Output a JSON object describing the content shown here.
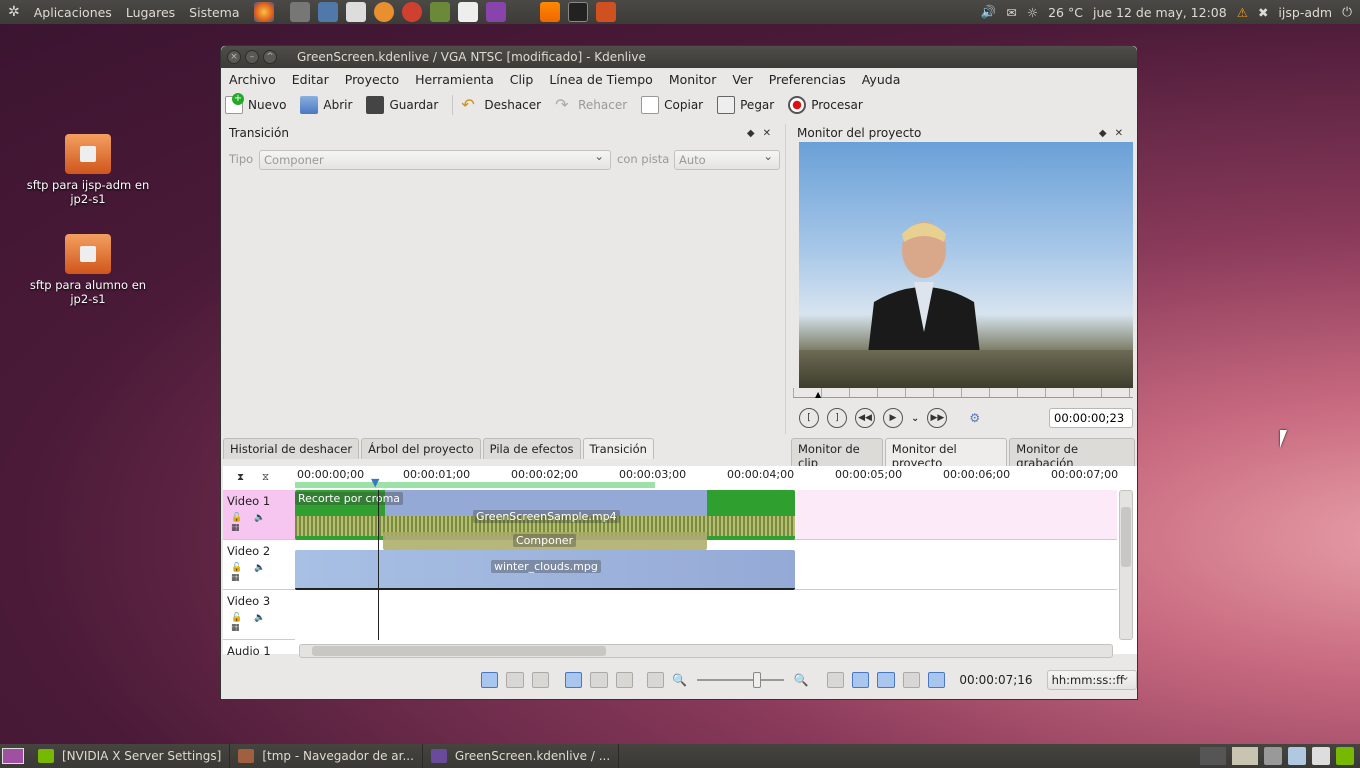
{
  "top_panel": {
    "menus": [
      "Aplicaciones",
      "Lugares",
      "Sistema"
    ],
    "weather": "26 °C",
    "datetime": "jue 12 de may, 12:08",
    "user": "ijsp-adm"
  },
  "desktop_icons": [
    {
      "label": "sftp para ijsp-adm en jp2-s1"
    },
    {
      "label": "sftp para alumno en jp2-s1"
    }
  ],
  "window": {
    "title": "GreenScreen.kdenlive / VGA NTSC [modificado] - Kdenlive",
    "menus": [
      "Archivo",
      "Editar",
      "Proyecto",
      "Herramienta",
      "Clip",
      "Línea de Tiempo",
      "Monitor",
      "Ver",
      "Preferencias",
      "Ayuda"
    ],
    "toolbar": {
      "nuevo": "Nuevo",
      "abrir": "Abrir",
      "guardar": "Guardar",
      "deshacer": "Deshacer",
      "rehacer": "Rehacer",
      "copiar": "Copiar",
      "pegar": "Pegar",
      "procesar": "Procesar"
    },
    "transition_panel": {
      "title": "Transición",
      "tipo_label": "Tipo",
      "tipo_value": "Componer",
      "pista_label": "con pista",
      "pista_value": "Auto"
    },
    "left_tabs": [
      "Historial de deshacer",
      "Árbol del proyecto",
      "Pila de efectos",
      "Transición"
    ],
    "monitor_panel": {
      "title": "Monitor del proyecto",
      "timecode": "00:00:00;23"
    },
    "right_tabs": [
      "Monitor de clip",
      "Monitor del proyecto",
      "Monitor de grabación"
    ],
    "timeline": {
      "ruler": [
        "00:00:00;00",
        "00:00:01;00",
        "00:00:02;00",
        "00:00:03;00",
        "00:00:04;00",
        "00:00:05;00",
        "00:00:06;00",
        "00:00:07;00"
      ],
      "tracks": [
        "Video 1",
        "Video 2",
        "Video 3",
        "Audio 1"
      ],
      "clips": {
        "effect_label": "Recorte por croma",
        "clip1": "GreenScreenSample.mp4",
        "transition": "Componer",
        "clip2": "winter_clouds.mpg"
      }
    },
    "bottom": {
      "duration": "00:00:07;16",
      "format": "hh:mm:ss::ff"
    }
  },
  "taskbar": {
    "tasks": [
      "[NVIDIA X Server Settings]",
      "[tmp - Navegador de ar...",
      "GreenScreen.kdenlive / ..."
    ]
  }
}
